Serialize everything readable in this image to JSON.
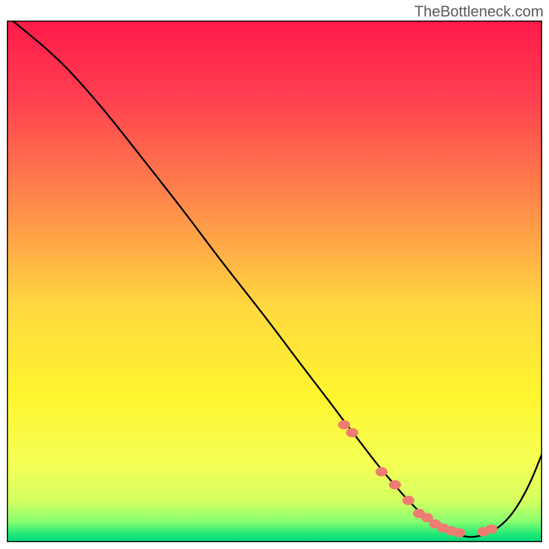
{
  "watermark": "TheBottleneck.com",
  "chart_data": {
    "type": "line",
    "title": "",
    "xlabel": "",
    "ylabel": "",
    "xlim": [
      0,
      100
    ],
    "ylim": [
      0,
      100
    ],
    "curve": {
      "x": [
        1,
        4,
        8,
        12,
        18,
        25,
        33,
        40,
        48,
        55,
        60,
        63,
        66,
        69,
        72,
        75,
        78,
        81,
        84,
        87,
        90,
        92,
        94,
        96,
        98,
        100
      ],
      "y": [
        100,
        97.5,
        94,
        90,
        83,
        74,
        63.5,
        54,
        43.5,
        34,
        27.3,
        23.2,
        19.2,
        15.2,
        11.5,
        8,
        5,
        2.8,
        1.5,
        1,
        1.8,
        3,
        5,
        8,
        12,
        17
      ]
    },
    "markers": {
      "x": [
        63,
        64.5,
        70,
        72.5,
        75,
        77,
        78.5,
        80,
        81.5,
        83,
        84.5,
        89,
        90.5
      ],
      "y": [
        22.5,
        21,
        13.5,
        11,
        8,
        5.5,
        4.7,
        3.5,
        2.7,
        2.2,
        1.8,
        2,
        2.5
      ],
      "color": "#ed7d71",
      "size": 8
    },
    "gradient_stops": [
      {
        "offset": 0,
        "color": "#ff1a4a"
      },
      {
        "offset": 0.15,
        "color": "#ff4050"
      },
      {
        "offset": 0.35,
        "color": "#ff8a4a"
      },
      {
        "offset": 0.55,
        "color": "#ffd940"
      },
      {
        "offset": 0.72,
        "color": "#fff52e"
      },
      {
        "offset": 0.85,
        "color": "#f5ff55"
      },
      {
        "offset": 0.92,
        "color": "#d5ff60"
      },
      {
        "offset": 0.96,
        "color": "#8aff70"
      },
      {
        "offset": 0.985,
        "color": "#20e878"
      },
      {
        "offset": 1,
        "color": "#00d67a"
      }
    ]
  }
}
